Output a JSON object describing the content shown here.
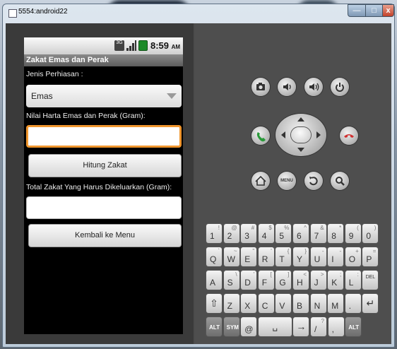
{
  "window": {
    "title": "5554:android22",
    "min_label": "—",
    "max_label": "□",
    "close_label": "x"
  },
  "status_bar": {
    "network_label": "3G",
    "time": "8:59",
    "ampm": "AM"
  },
  "app": {
    "title": "Zakat Emas dan Perak",
    "jenis_label": "Jenis Perhiasan :",
    "jenis_value": "Emas",
    "nilai_label": "Nilai Harta Emas dan Perak (Gram):",
    "nilai_value": "",
    "hitung_button": "Hitung Zakat",
    "total_label": "Total Zakat Yang Harus Dikeluarkan (Gram):",
    "total_value": "",
    "kembali_button": "Kembali ke Menu"
  },
  "controls": {
    "camera_icon": "camera-icon",
    "volume_down_icon": "volume-down-icon",
    "volume_up_icon": "volume-up-icon",
    "power_icon": "power-icon",
    "call_icon": "call-icon",
    "end_call_icon": "end-call-icon",
    "home_icon": "home-icon",
    "menu_label": "MENU",
    "back_icon": "back-icon",
    "search_icon": "search-icon"
  },
  "keyboard": {
    "rows": [
      [
        {
          "k": "1",
          "a": "!"
        },
        {
          "k": "2",
          "a": "@"
        },
        {
          "k": "3",
          "a": "#"
        },
        {
          "k": "4",
          "a": "$"
        },
        {
          "k": "5",
          "a": "%"
        },
        {
          "k": "6",
          "a": "^"
        },
        {
          "k": "7",
          "a": "&"
        },
        {
          "k": "8",
          "a": "*"
        },
        {
          "k": "9",
          "a": "("
        },
        {
          "k": "0",
          "a": ")"
        }
      ],
      [
        {
          "k": "Q",
          "a": "`"
        },
        {
          "k": "W",
          "a": "~"
        },
        {
          "k": "E",
          "a": "\""
        },
        {
          "k": "R",
          "a": "'"
        },
        {
          "k": "T",
          "a": "{"
        },
        {
          "k": "Y",
          "a": "}"
        },
        {
          "k": "U",
          "a": "-"
        },
        {
          "k": "I",
          "a": "-"
        },
        {
          "k": "O",
          "a": "+"
        },
        {
          "k": "P",
          "a": "="
        }
      ],
      [
        {
          "k": "A",
          "a": ""
        },
        {
          "k": "S",
          "a": "\\"
        },
        {
          "k": "D",
          "a": "'"
        },
        {
          "k": "F",
          "a": "["
        },
        {
          "k": "G",
          "a": "]"
        },
        {
          "k": "H",
          "a": "<"
        },
        {
          "k": "J",
          "a": ">"
        },
        {
          "k": "K",
          "a": ";"
        },
        {
          "k": "L",
          "a": ":"
        },
        {
          "k": "DEL",
          "a": ""
        }
      ],
      [
        {
          "k": "⇧",
          "a": ""
        },
        {
          "k": "Z",
          "a": ""
        },
        {
          "k": "X",
          "a": ""
        },
        {
          "k": "C",
          "a": ""
        },
        {
          "k": "V",
          "a": ""
        },
        {
          "k": "B",
          "a": ""
        },
        {
          "k": "N",
          "a": ""
        },
        {
          "k": "M",
          "a": ""
        },
        {
          "k": ".",
          "a": ""
        },
        {
          "k": "↵",
          "a": ""
        }
      ],
      [
        {
          "k": "ALT",
          "a": ""
        },
        {
          "k": "SYM",
          "a": ""
        },
        {
          "k": "@",
          "a": ""
        },
        {
          "k": "␣",
          "a": ""
        },
        {
          "k": "→",
          "a": ""
        },
        {
          "k": "/",
          "a": "?"
        },
        {
          "k": ",",
          "a": ""
        },
        {
          "k": "ALT",
          "a": ""
        }
      ]
    ]
  },
  "colors": {
    "focus_border": "#f0962e",
    "call_green": "#2a9a3a",
    "end_red": "#d03030"
  }
}
